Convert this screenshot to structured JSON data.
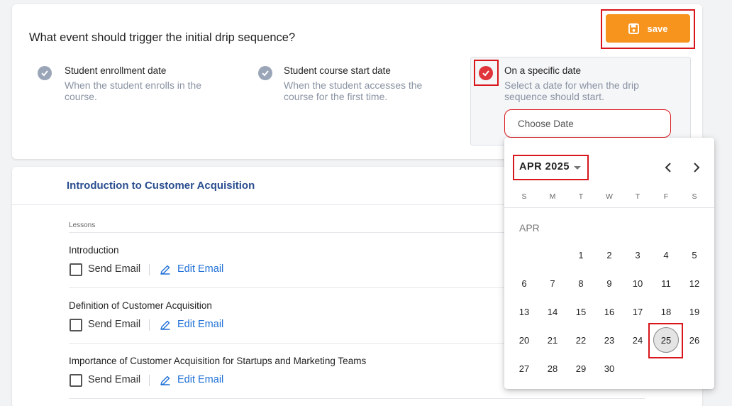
{
  "trigger": {
    "question": "What event should trigger the initial drip sequence?",
    "save_label": "save",
    "options": [
      {
        "title": "Student enrollment date",
        "desc_line1": "When the student enrolls in the",
        "desc_line2": "course."
      },
      {
        "title": "Student course start date",
        "desc_line1": "When the student accesses the",
        "desc_line2": "course for the first time."
      },
      {
        "title": "On a specific date",
        "desc_line1": "Select a date for when the drip",
        "desc_line2": "sequence should start."
      }
    ],
    "date_placeholder": "Choose Date"
  },
  "section": {
    "title": "Introduction to Customer Acquisition",
    "lessons_label": "Lessons",
    "send_label": "Send Email",
    "edit_label": "Edit Email",
    "lessons": [
      {
        "title": "Introduction"
      },
      {
        "title": "Definition of Customer Acquisition"
      },
      {
        "title": "Importance of Customer Acquisition for Startups and Marketing Teams"
      }
    ]
  },
  "calendar": {
    "month_year": "APR 2025",
    "month_label": "APR",
    "weekdays": [
      "S",
      "M",
      "T",
      "W",
      "T",
      "F",
      "S"
    ],
    "first_weekday_index": 2,
    "days_in_month": 30,
    "selected_day": 25
  },
  "colors": {
    "accent": "#f7941d",
    "highlight": "#d8161b",
    "link": "#1e6fd6",
    "section_title": "#2a4d8f",
    "check_gray": "#9aa6b8",
    "check_red": "#e0353c"
  }
}
